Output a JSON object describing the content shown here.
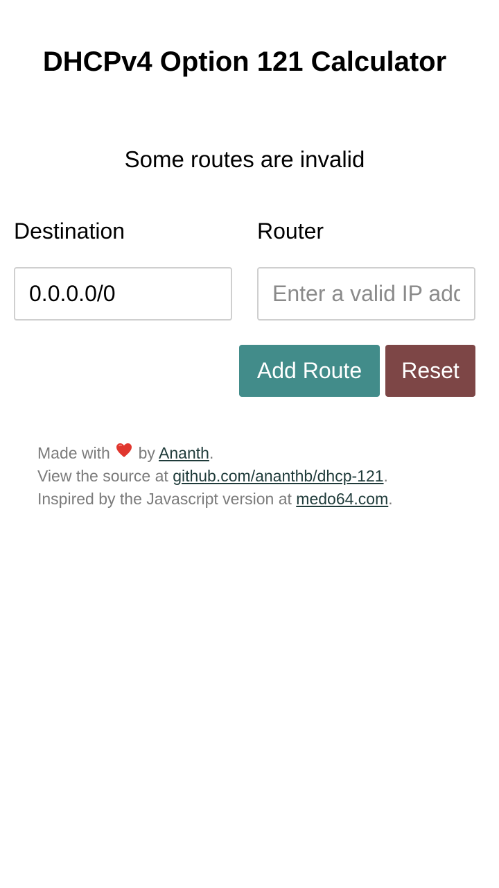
{
  "header": {
    "title": "DHCPv4 Option 121 Calculator"
  },
  "status": {
    "message": "Some routes are invalid"
  },
  "form": {
    "destination_label": "Destination",
    "router_label": "Router",
    "destination_value": "0.0.0.0/0",
    "router_placeholder": "Enter a valid IP address"
  },
  "buttons": {
    "add_label": "Add Route",
    "reset_label": "Reset",
    "add_color": "#428c8a",
    "reset_color": "#7d4646"
  },
  "footer": {
    "line1_prefix": "Made with",
    "line1_icon": "heart-icon",
    "line1_by": "by",
    "line1_link": "Ananth",
    "line1_suffix": ".",
    "line2_prefix": "View the source at",
    "line2_link": "github.com/ananthb/dhcp-121",
    "line2_suffix": ".",
    "line3_prefix": "Inspired by the Javascript version at",
    "line3_link": "medo64.com",
    "line3_suffix": "."
  }
}
